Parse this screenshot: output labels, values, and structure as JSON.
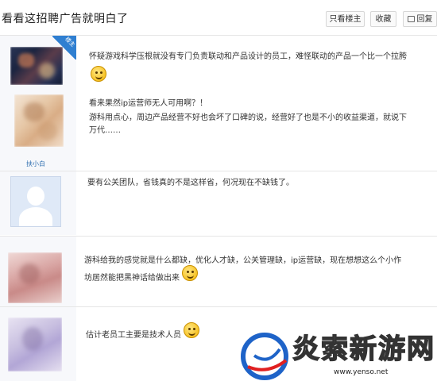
{
  "thread": {
    "title": "看看这招聘广告就明白了",
    "only_author_label": "只看楼主",
    "favorite_label": "收藏",
    "reply_label": "回复"
  },
  "posts": [
    {
      "badge": "楼主",
      "username": "",
      "line1": "怀疑游戏科学压根就没有专门负责联动和产品设计的员工，难怪联动的产品一个比一个拉胯",
      "line2": "看来果然ip运营师无人可用啊？！",
      "line3": "游科用点心，周边产品经营不好也会坏了口碑的说，经营好了也是不小的收益渠道，就说下",
      "line4": "万代……",
      "username2": "扶小白"
    },
    {
      "text": "要有公关团队，省钱真的不是这样省，何况现在不缺钱了。"
    },
    {
      "line1": "游科给我的感觉就是什么都缺，优化人才缺，公关管理缺，ip运营缺，现在想想这么个小作",
      "line2": "坊居然能把黑神话给做出来"
    },
    {
      "text": "估计老员工主要是技术人员"
    }
  ],
  "watermark": {
    "brand": "炎索新游网",
    "url": "www.yenso.net"
  },
  "colors": {
    "badge": "#2f7fd1",
    "username": "#2f6fb0",
    "sidebar_bg": "#f7f8fb",
    "watermark_blue": "#1e63c8"
  }
}
